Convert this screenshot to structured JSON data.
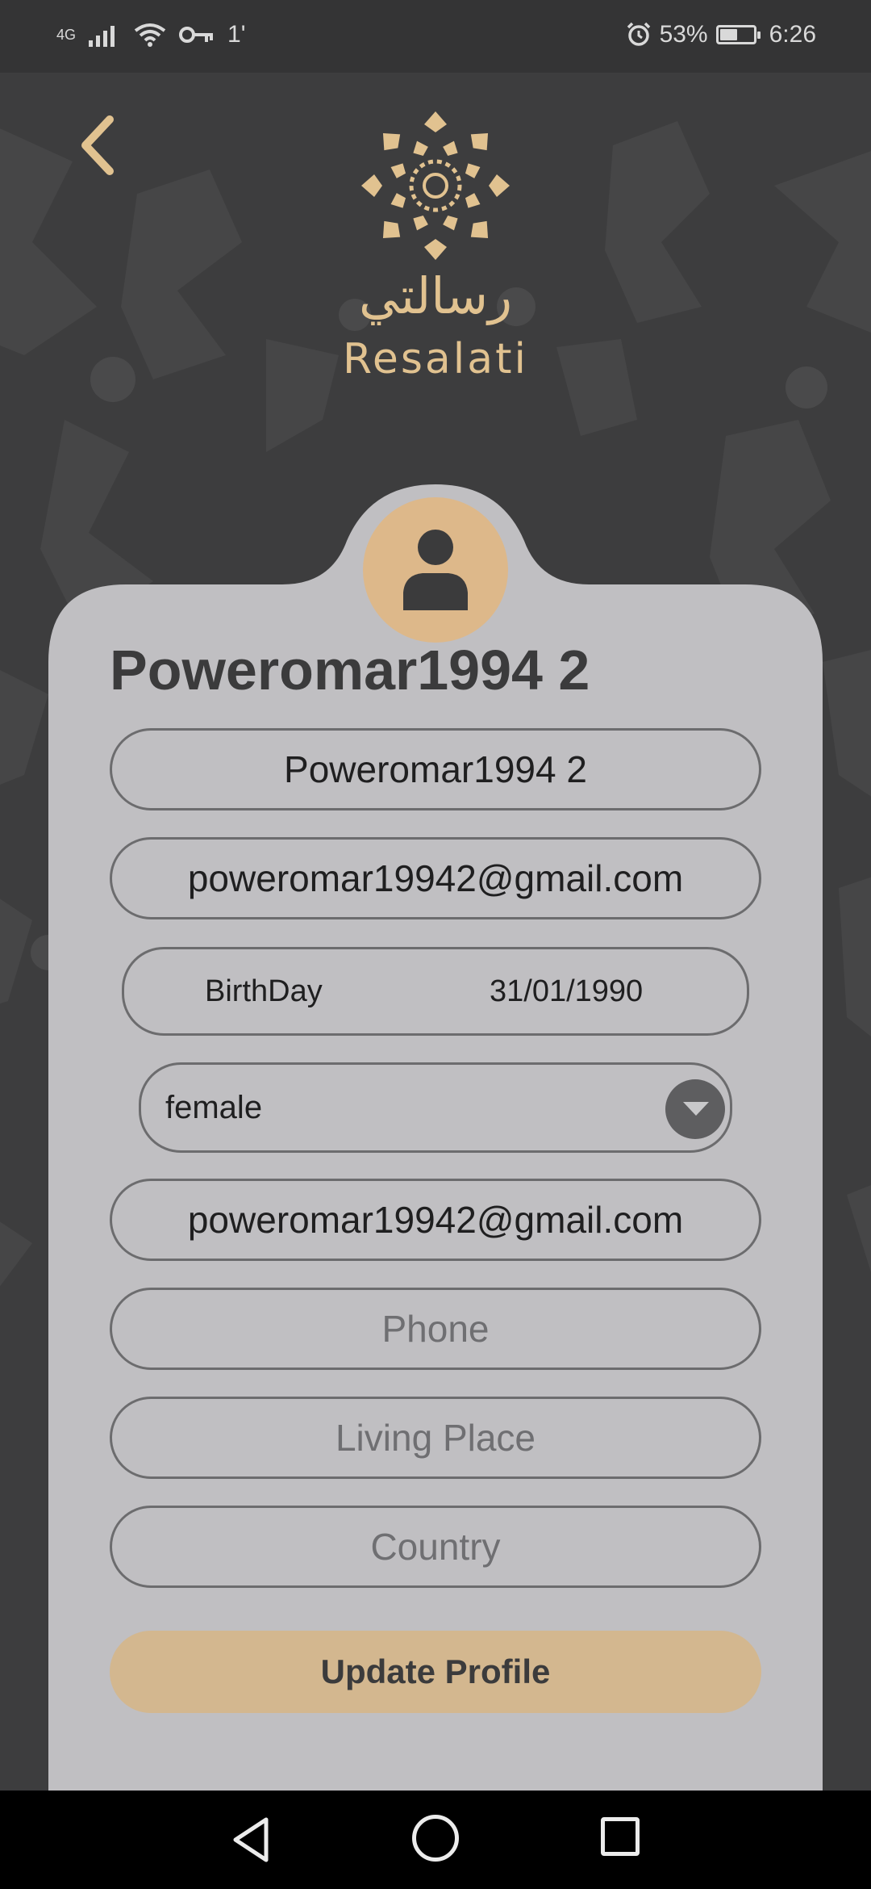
{
  "status_bar": {
    "network": "4G",
    "signal_icon": "signal-icon",
    "wifi_icon": "wifi-icon",
    "vpn_key_icon": "key-icon",
    "sync_arrows": "1'",
    "alarm_icon": "alarm-icon",
    "battery_percent": "53%",
    "battery_level": 0.53,
    "time": "6:26"
  },
  "header": {
    "back_icon": "chevron-left-icon",
    "logo_icon": "mandala-logo-icon",
    "logo_arabic": "رسالتي",
    "logo_latin": "Resalati"
  },
  "profile": {
    "avatar_icon": "user-icon",
    "title": "Poweromar1994 2",
    "name_value": "Poweromar1994 2",
    "email_value": "poweromar19942@gmail.com",
    "birthday_label": "BirthDay",
    "birthday_value": "31/01/1990",
    "gender_selected": "female",
    "gender_dropdown_icon": "caret-down-icon",
    "email2_value": "poweromar19942@gmail.com",
    "phone_placeholder": "Phone",
    "living_place_placeholder": "Living Place",
    "country_placeholder": "Country",
    "update_button": "Update Profile"
  },
  "nav_bar": {
    "back_icon": "triangle-back-icon",
    "home_icon": "circle-home-icon",
    "recents_icon": "square-recents-icon"
  },
  "colors": {
    "background": "#3d3d3e",
    "card": "#c0bfc2",
    "accent": "#ddb88a",
    "logo_gold": "#e1c290",
    "text_dark": "#3b3b3c"
  }
}
